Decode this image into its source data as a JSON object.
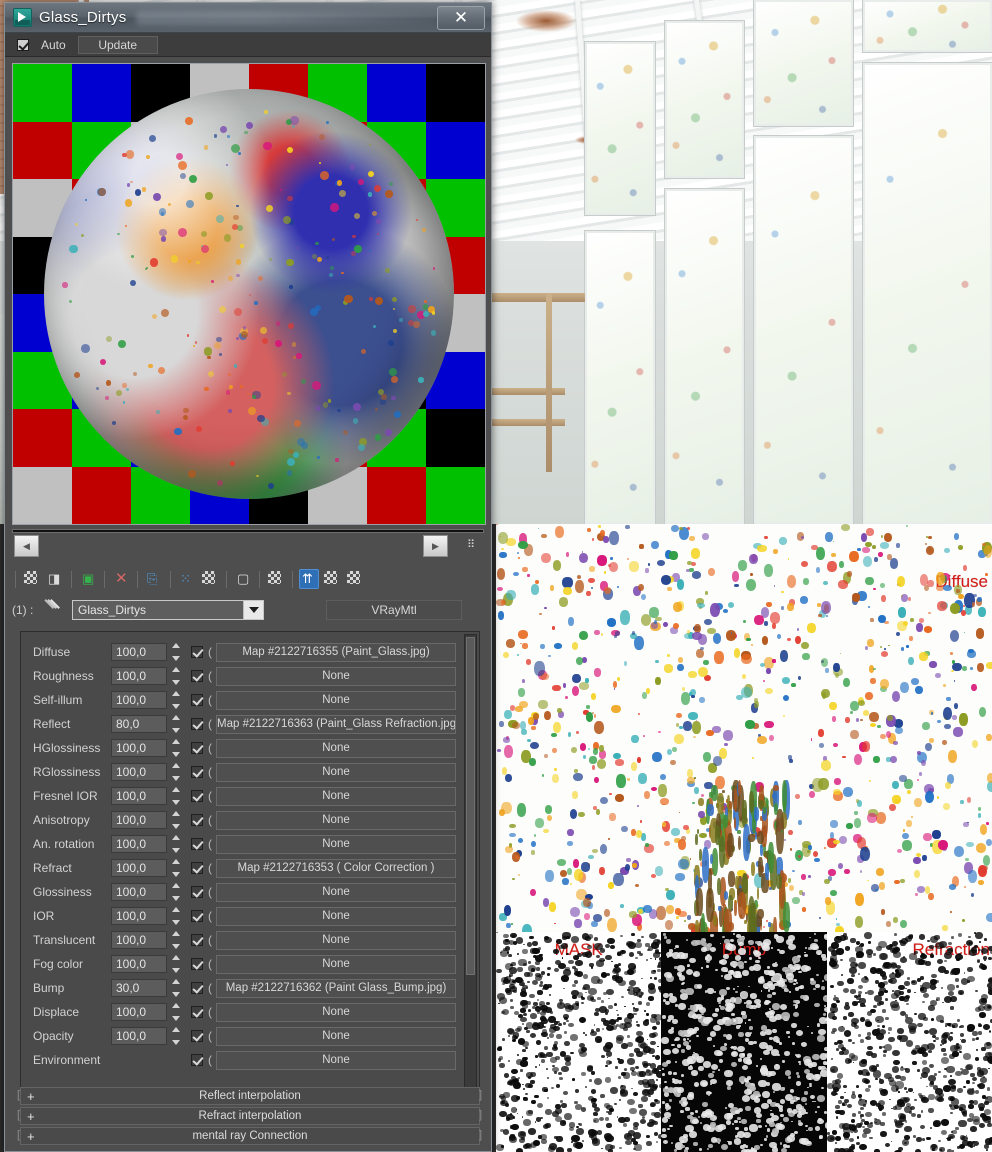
{
  "window": {
    "title": "Glass_Dirtys",
    "app_icon": "3dsmax-icon",
    "close_label": "✕"
  },
  "preview_bar": {
    "auto_label": "Auto",
    "auto_checked": true,
    "update_label": "Update"
  },
  "nav": {
    "prev_label": "◀",
    "next_label": "▶",
    "options_label": "⠿"
  },
  "toolbar": {
    "icons": [
      "get-material-icon",
      "put-material-to-scene-icon",
      "assign-material-to-selection-icon",
      "reset-map-icon",
      "make-material-copy-icon",
      "make-unique-icon",
      "put-to-library-icon",
      "material-effects-channel-icon",
      "show-map-in-viewport-icon",
      "show-end-result-icon",
      "go-to-parent-icon",
      "go-forward-to-sibling-icon"
    ],
    "selected_index": 9
  },
  "material": {
    "slot_index": "(1) :",
    "picker_icon": "eyedropper-icon",
    "name": "Glass_Dirtys",
    "type": "VRayMtl"
  },
  "params": {
    "columns": [
      "name",
      "amount",
      "enabled",
      "map"
    ],
    "rows": [
      {
        "name": "Diffuse",
        "amount": "100,0",
        "enabled": true,
        "map": "Map #2122716355 (Paint_Glass.jpg)"
      },
      {
        "name": "Roughness",
        "amount": "100,0",
        "enabled": true,
        "map": "None"
      },
      {
        "name": "Self-illum",
        "amount": "100,0",
        "enabled": true,
        "map": "None"
      },
      {
        "name": "Reflect",
        "amount": "80,0",
        "enabled": true,
        "map": "Map #2122716363 (Paint_Glass Refraction.jpg)"
      },
      {
        "name": "HGlossiness",
        "amount": "100,0",
        "enabled": true,
        "map": "None"
      },
      {
        "name": "RGlossiness",
        "amount": "100,0",
        "enabled": true,
        "map": "None"
      },
      {
        "name": "Fresnel IOR",
        "amount": "100,0",
        "enabled": true,
        "map": "None"
      },
      {
        "name": "Anisotropy",
        "amount": "100,0",
        "enabled": true,
        "map": "None"
      },
      {
        "name": "An. rotation",
        "amount": "100,0",
        "enabled": true,
        "map": "None"
      },
      {
        "name": "Refract",
        "amount": "100,0",
        "enabled": true,
        "map": "Map #2122716353  ( Color Correction )"
      },
      {
        "name": "Glossiness",
        "amount": "100,0",
        "enabled": true,
        "map": "None"
      },
      {
        "name": "IOR",
        "amount": "100,0",
        "enabled": true,
        "map": "None"
      },
      {
        "name": "Translucent",
        "amount": "100,0",
        "enabled": true,
        "map": "None"
      },
      {
        "name": "Fog color",
        "amount": "100,0",
        "enabled": true,
        "map": "None"
      },
      {
        "name": "Bump",
        "amount": "30,0",
        "enabled": true,
        "map": "Map #2122716362 (Paint Glass_Bump.jpg)"
      },
      {
        "name": "Displace",
        "amount": "100,0",
        "enabled": true,
        "map": "None"
      },
      {
        "name": "Opacity",
        "amount": "100,0",
        "enabled": true,
        "map": "None"
      },
      {
        "name": "Environment",
        "amount": "",
        "enabled": true,
        "map": "None"
      }
    ]
  },
  "rollouts": [
    {
      "expander": "+",
      "title": "Reflect interpolation"
    },
    {
      "expander": "+",
      "title": "Refract interpolation"
    },
    {
      "expander": "+",
      "title": "mental ray Connection"
    }
  ],
  "texture_labels": {
    "diffuse": "Diffuse",
    "mask": "MASK",
    "bump": "Bump",
    "refraction": "Refraction"
  },
  "colors": {
    "label_red": "#d61b16",
    "dialog_bg": "#4e4e4e",
    "panel_bg": "#4a4a4a",
    "accent_blue": "#2f6fb5",
    "checker_green": "#00c000",
    "checker_blue": "#0000d0",
    "checker_red": "#c00000",
    "checker_black": "#000000",
    "checker_silver": "#c0c0c0"
  },
  "preview_checker": [
    [
      "green",
      "blue",
      "black",
      "silver",
      "red",
      "green",
      "blue",
      "black"
    ],
    [
      "red",
      "green",
      "silver",
      "blue",
      "black",
      "red",
      "green",
      "blue"
    ],
    [
      "silver",
      "red",
      "green",
      "black",
      "blue",
      "silver",
      "red",
      "green"
    ],
    [
      "black",
      "silver",
      "red",
      "green",
      "black",
      "blue",
      "silver",
      "red"
    ],
    [
      "blue",
      "black",
      "silver",
      "red",
      "green",
      "black",
      "blue",
      "silver"
    ],
    [
      "green",
      "blue",
      "black",
      "silver",
      "red",
      "green",
      "black",
      "blue"
    ],
    [
      "red",
      "green",
      "blue",
      "black",
      "silver",
      "red",
      "green",
      "black"
    ],
    [
      "silver",
      "red",
      "green",
      "blue",
      "black",
      "silver",
      "red",
      "green"
    ]
  ]
}
